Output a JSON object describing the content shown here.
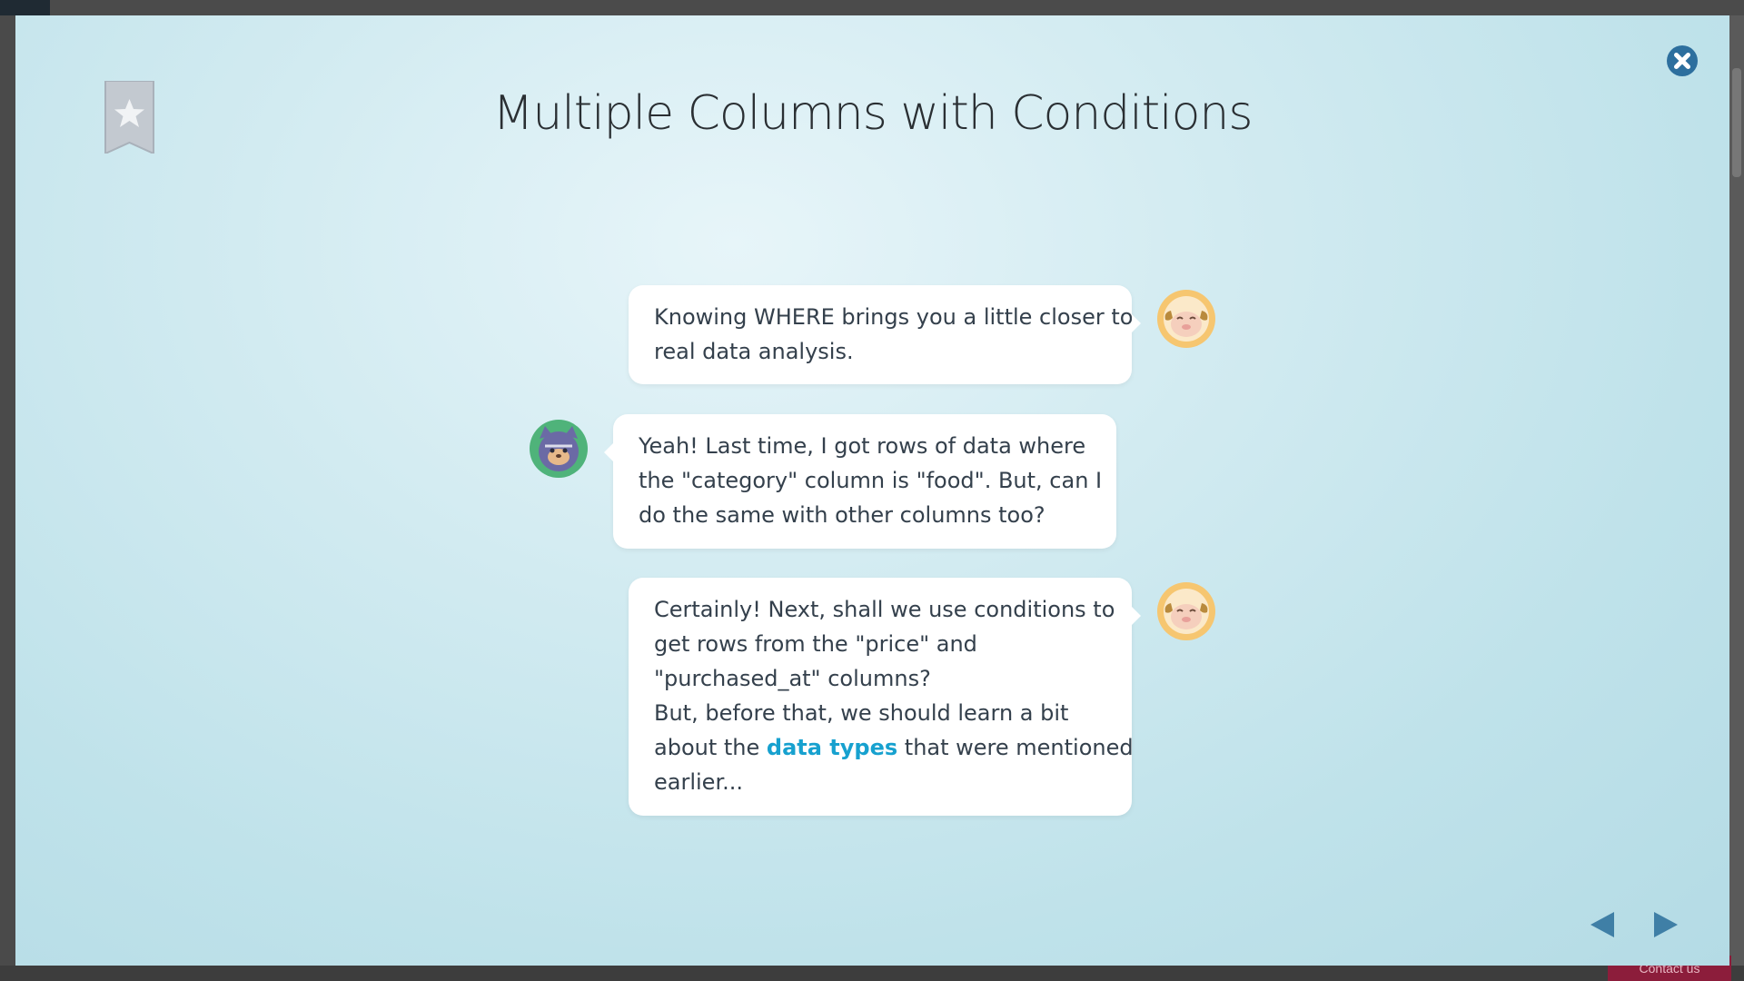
{
  "page": {
    "title": "Multiple Columns with Conditions"
  },
  "underlying": {
    "contact_label": "Contact us"
  },
  "messages": [
    {
      "speaker": "sheep",
      "side": "right",
      "lines": [
        "Knowing WHERE brings you a little closer to",
        "real data analysis."
      ]
    },
    {
      "speaker": "cat",
      "side": "left",
      "lines": [
        "Yeah! Last time, I got rows of data where",
        "the \"category\" column is \"food\". But, can I",
        "do the same with other columns too?"
      ]
    },
    {
      "speaker": "sheep",
      "side": "right",
      "lines": [
        "Certainly! Next, shall we use conditions to",
        "get rows from the \"price\" and",
        "\"purchased_at\" columns?",
        "But, before that, we should learn a bit"
      ],
      "line5_before": "about the ",
      "line5_link": "data types",
      "line5_after": " that were mentioned",
      "line6": "earlier..."
    }
  ],
  "icons": {
    "bookmark": "bookmark-star-icon",
    "close": "close-icon",
    "prev": "prev-arrow-icon",
    "next": "next-arrow-icon",
    "sheep": "sheep-avatar",
    "cat": "cat-avatar"
  },
  "colors": {
    "link": "#17a1cf",
    "close_button": "#2d6f9e",
    "nav_arrow": "#3f7fa6",
    "text": "#34404c"
  }
}
